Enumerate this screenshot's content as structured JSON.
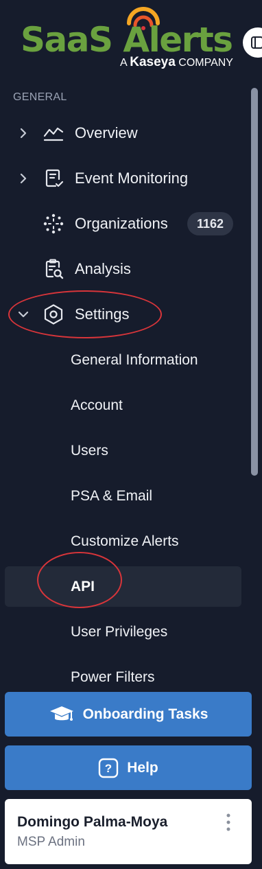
{
  "brand": {
    "logo_text": "SaaS Alerts",
    "logo_sub_prefix": "A",
    "logo_sub_brand": "Kaseya",
    "logo_sub_suffix": "COMPANY",
    "logo_color": "#6aa13f",
    "signal_color": "#f5a623"
  },
  "sidebar": {
    "section_label": "GENERAL",
    "items": [
      {
        "label": "Overview",
        "icon": "chart-line-icon",
        "expandable": true,
        "expanded": false
      },
      {
        "label": "Event Monitoring",
        "icon": "clipboard-check-icon",
        "expandable": true,
        "expanded": false
      },
      {
        "label": "Organizations",
        "icon": "network-icon",
        "badge": "1162"
      },
      {
        "label": "Analysis",
        "icon": "clipboard-search-icon"
      },
      {
        "label": "Settings",
        "icon": "settings-hexagon-icon",
        "expandable": true,
        "expanded": true
      }
    ],
    "settings_children": [
      {
        "label": "General Information"
      },
      {
        "label": "Account"
      },
      {
        "label": "Users"
      },
      {
        "label": "PSA & Email"
      },
      {
        "label": "Customize Alerts"
      },
      {
        "label": "API",
        "active": true
      },
      {
        "label": "User Privileges"
      },
      {
        "label": "Power Filters"
      }
    ]
  },
  "actions": {
    "onboarding_label": "Onboarding Tasks",
    "help_label": "Help"
  },
  "user": {
    "name": "Domingo Palma-Moya",
    "role": "MSP Admin"
  },
  "colors": {
    "background": "#161c2c",
    "active_row": "#232a39",
    "button": "#3a7bc8",
    "annotation": "#d8353a"
  }
}
